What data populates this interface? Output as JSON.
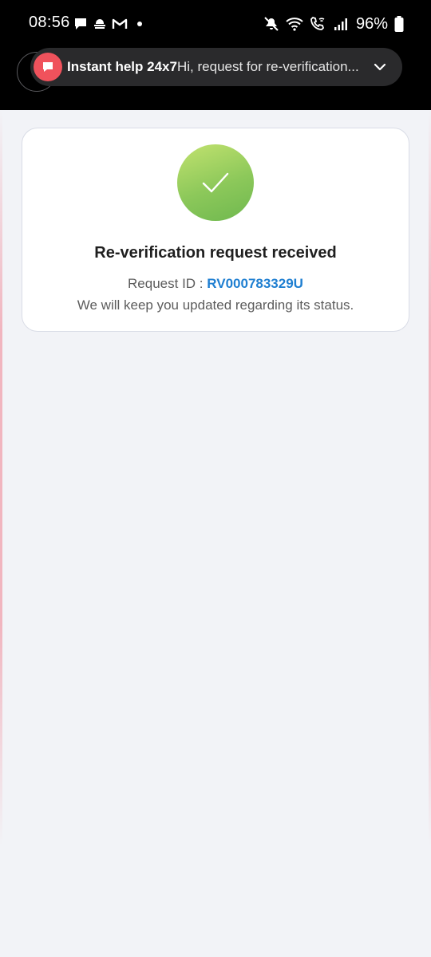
{
  "status_bar": {
    "time": "08:56",
    "battery": "96%",
    "left_icons": [
      "chat-icon",
      "cloud-icon",
      "gmail-icon",
      "dot-icon"
    ],
    "right_icons": [
      "mute-icon",
      "wifi-icon",
      "wifi-calling-icon",
      "signal-icon",
      "battery-icon"
    ]
  },
  "notification": {
    "title": "Instant help 24x7",
    "text": "Hi, request for re-verification...",
    "icon": "chat-icon",
    "accent": "#f0525c"
  },
  "card": {
    "icon": "check-icon",
    "title": "Re-verification request received",
    "request_label": "Request ID :",
    "request_id": "RV000783329U",
    "status_message": "We will keep you updated regarding its status.",
    "id_color": "#1f7fd1",
    "success_color": "#8cc85a"
  }
}
